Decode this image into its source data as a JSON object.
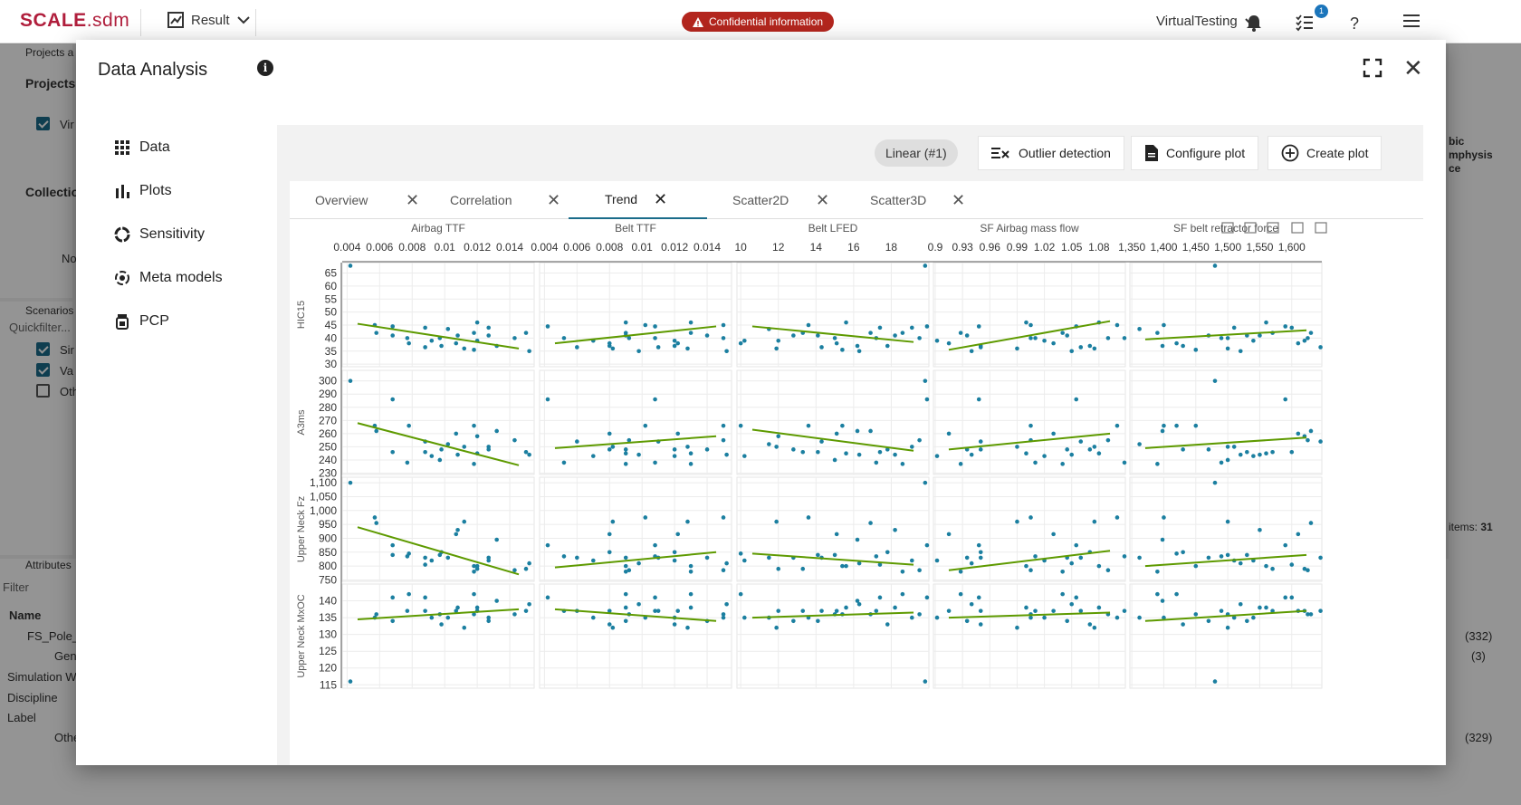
{
  "app": {
    "logo_brand": "SCALE",
    "logo_suffix": ".sdm",
    "result_label": "Result",
    "confidential": "Confidential information",
    "workspace": "VirtualTesting",
    "notification_count": "1"
  },
  "background": {
    "projects_tab": "Projects a",
    "projects_header": "Projects",
    "project_item": "Vir",
    "collections_header": "Collectio",
    "no_text": "No",
    "scenarios_tab": "Scenarios",
    "quickfilter": "Quickfilter...",
    "scenario_items": [
      "Sir",
      "Va",
      "Oth"
    ],
    "attributes_tab": "Attributes",
    "filter_placeholder": "Filter",
    "name_header": "Name",
    "tree_rows": [
      "FS_Pole_",
      "Gen",
      "Simulation Wa",
      "Discipline",
      "Label",
      "Others"
    ],
    "counts": [
      "(332)",
      "(3)",
      "(329)"
    ],
    "items_label": "items:",
    "items_count": "31",
    "right_fragment": "bic\nmphysis\nce"
  },
  "modal": {
    "title": "Data Analysis",
    "nav": [
      "Data",
      "Plots",
      "Sensitivity",
      "Meta models",
      "PCP"
    ],
    "chip": "Linear (#1)",
    "buttons": {
      "outlier": "Outlier detection",
      "configure": "Configure plot",
      "create": "Create plot"
    },
    "tabs": [
      "Overview",
      "Correlation",
      "Trend",
      "Scatter2D",
      "Scatter3D"
    ],
    "active_tab": "Trend"
  },
  "colors": {
    "point": "#1b7fa0",
    "trend": "#5e9a00",
    "brand": "#b01e3c",
    "accent": "#1b6c8a"
  },
  "chart_data": {
    "type": "scatter",
    "x_variables": [
      {
        "name": "Airbag TTF",
        "ticks": [
          "0.004",
          "0.006",
          "0.008",
          "0.01",
          "0.012",
          "0.014"
        ],
        "tick_values": [
          0.004,
          0.006,
          0.008,
          0.01,
          0.012,
          0.014
        ],
        "range": [
          0.0037,
          0.0155
        ]
      },
      {
        "name": "Belt TTF",
        "ticks": [
          "0.004",
          "0.006",
          "0.008",
          "0.01",
          "0.012",
          "0.014"
        ],
        "tick_values": [
          0.004,
          0.006,
          0.008,
          0.01,
          0.012,
          0.014
        ],
        "range": [
          0.0037,
          0.0155
        ]
      },
      {
        "name": "Belt LFED",
        "ticks": [
          "10",
          "12",
          "14",
          "16",
          "18"
        ],
        "tick_values": [
          10,
          12,
          14,
          16,
          18
        ],
        "range": [
          9.8,
          20
        ]
      },
      {
        "name": "SF Airbag mass flow",
        "ticks": [
          "0.9",
          "0.93",
          "0.96",
          "0.99",
          "1.02",
          "1.05",
          "1.08"
        ],
        "tick_values": [
          0.9,
          0.93,
          0.96,
          0.99,
          1.02,
          1.05,
          1.08
        ],
        "range": [
          0.898,
          1.109
        ]
      },
      {
        "name": "SF belt retractor force",
        "ticks": [
          "1,350",
          "1,400",
          "1,450",
          "1,500",
          "1,550",
          "1,600"
        ],
        "tick_values": [
          1350,
          1400,
          1450,
          1500,
          1550,
          1600
        ],
        "range": [
          1347,
          1647
        ]
      }
    ],
    "y_variables": [
      {
        "name": "HIC15",
        "ticks": [
          "65",
          "60",
          "55",
          "50",
          "45",
          "40",
          "35",
          "30"
        ],
        "tick_values": [
          65,
          60,
          55,
          50,
          45,
          40,
          35,
          30
        ],
        "range": [
          29,
          69
        ]
      },
      {
        "name": "A3ms",
        "ticks": [
          "300",
          "290",
          "280",
          "270",
          "260",
          "250",
          "240",
          "230"
        ],
        "tick_values": [
          300,
          290,
          280,
          270,
          260,
          250,
          240,
          230
        ],
        "range": [
          229,
          308
        ]
      },
      {
        "name": "Upper Neck Fz",
        "ticks": [
          "1,100",
          "1,050",
          "1,000",
          "950",
          "900",
          "850",
          "800",
          "750"
        ],
        "tick_values": [
          1100,
          1050,
          1000,
          950,
          900,
          850,
          800,
          750
        ],
        "range": [
          745,
          1120
        ]
      },
      {
        "name": "Upper Neck MxOC",
        "ticks": [
          "140",
          "135",
          "130",
          "125",
          "120",
          "115"
        ],
        "tick_values": [
          140,
          135,
          130,
          125,
          120,
          115
        ],
        "range": [
          114,
          145
        ]
      }
    ],
    "y_samples": {
      "HIC15": [
        67.8,
        45,
        42,
        44.5,
        41,
        40,
        38,
        36.5,
        44,
        39,
        40,
        37,
        43.5,
        38,
        41,
        36,
        35.5,
        42,
        39,
        46,
        44,
        41,
        37,
        40,
        42,
        35
      ],
      "A3ms": [
        300,
        266,
        262,
        286,
        246,
        238,
        266,
        254,
        246,
        243,
        240,
        248,
        252,
        260,
        244,
        250,
        266,
        237,
        258,
        245,
        250,
        248,
        262,
        255,
        246,
        244
      ],
      "Upper Neck Fz": [
        1100,
        975,
        955,
        875,
        840,
        835,
        845,
        830,
        805,
        820,
        840,
        850,
        830,
        915,
        930,
        960,
        800,
        780,
        790,
        800,
        820,
        830,
        895,
        785,
        790,
        810
      ],
      "Upper Neck MxOC": [
        116,
        135,
        136,
        141,
        134,
        137,
        142,
        137,
        141,
        135,
        136,
        133,
        135,
        137,
        138,
        132,
        136,
        142,
        137,
        138,
        135,
        134,
        140,
        136,
        137,
        139
      ]
    },
    "x_samples": {
      "Airbag TTF": [
        0.0042,
        0.0057,
        0.0058,
        0.0068,
        0.0068,
        0.0077,
        0.0078,
        0.0088,
        0.0088,
        0.0092,
        0.0097,
        0.0098,
        0.0102,
        0.0107,
        0.0108,
        0.0112,
        0.0118,
        0.0118,
        0.012,
        0.012,
        0.0127,
        0.0127,
        0.0132,
        0.0143,
        0.015,
        0.0152
      ],
      "Belt TTF": [
        0.0042,
        0.0052,
        0.006,
        0.007,
        0.008,
        0.008,
        0.0082,
        0.009,
        0.009,
        0.009,
        0.0092,
        0.0098,
        0.0102,
        0.0108,
        0.0108,
        0.011,
        0.012,
        0.012,
        0.0122,
        0.0128,
        0.013,
        0.013,
        0.014,
        0.015,
        0.0152,
        0.015
      ],
      "Belt LFED": [
        10.0,
        10.2,
        11.5,
        11.9,
        12.0,
        12.8,
        13.3,
        13.6,
        14.1,
        14.3,
        15.0,
        15.1,
        15.4,
        15.6,
        16.2,
        16.3,
        16.9,
        17.2,
        17.4,
        17.8,
        18.2,
        18.6,
        19.1,
        19.5,
        19.8,
        19.9
      ],
      "SF Airbag mass flow": [
        0.902,
        0.915,
        0.928,
        0.935,
        0.94,
        0.948,
        0.95,
        0.95,
        0.99,
        1.0,
        1.005,
        1.005,
        1.01,
        1.02,
        1.03,
        1.04,
        1.045,
        1.05,
        1.055,
        1.06,
        1.07,
        1.075,
        1.08,
        1.09,
        1.1,
        1.108
      ],
      "SF belt retractor force": [
        1362,
        1390,
        1398,
        1400,
        1420,
        1430,
        1450,
        1470,
        1480,
        1490,
        1500,
        1500,
        1510,
        1520,
        1530,
        1540,
        1550,
        1560,
        1570,
        1590,
        1600,
        1610,
        1620,
        1625,
        1630,
        1645
      ]
    },
    "trend_lines": [
      [
        [
          45.5,
          36
        ],
        [
          38,
          44.5
        ],
        [
          44.5,
          38.5
        ],
        [
          35.5,
          46.5
        ],
        [
          39.5,
          43
        ]
      ],
      [
        [
          268,
          236
        ],
        [
          249,
          258
        ],
        [
          263,
          247
        ],
        [
          248,
          260
        ],
        [
          249,
          257
        ]
      ],
      [
        [
          940,
          770
        ],
        [
          795,
          850
        ],
        [
          845,
          805
        ],
        [
          785,
          855
        ],
        [
          800,
          840
        ]
      ],
      [
        [
          134.5,
          137.5
        ],
        [
          137.5,
          134
        ],
        [
          135,
          136.5
        ],
        [
          135,
          136.5
        ],
        [
          134,
          137
        ]
      ]
    ]
  }
}
